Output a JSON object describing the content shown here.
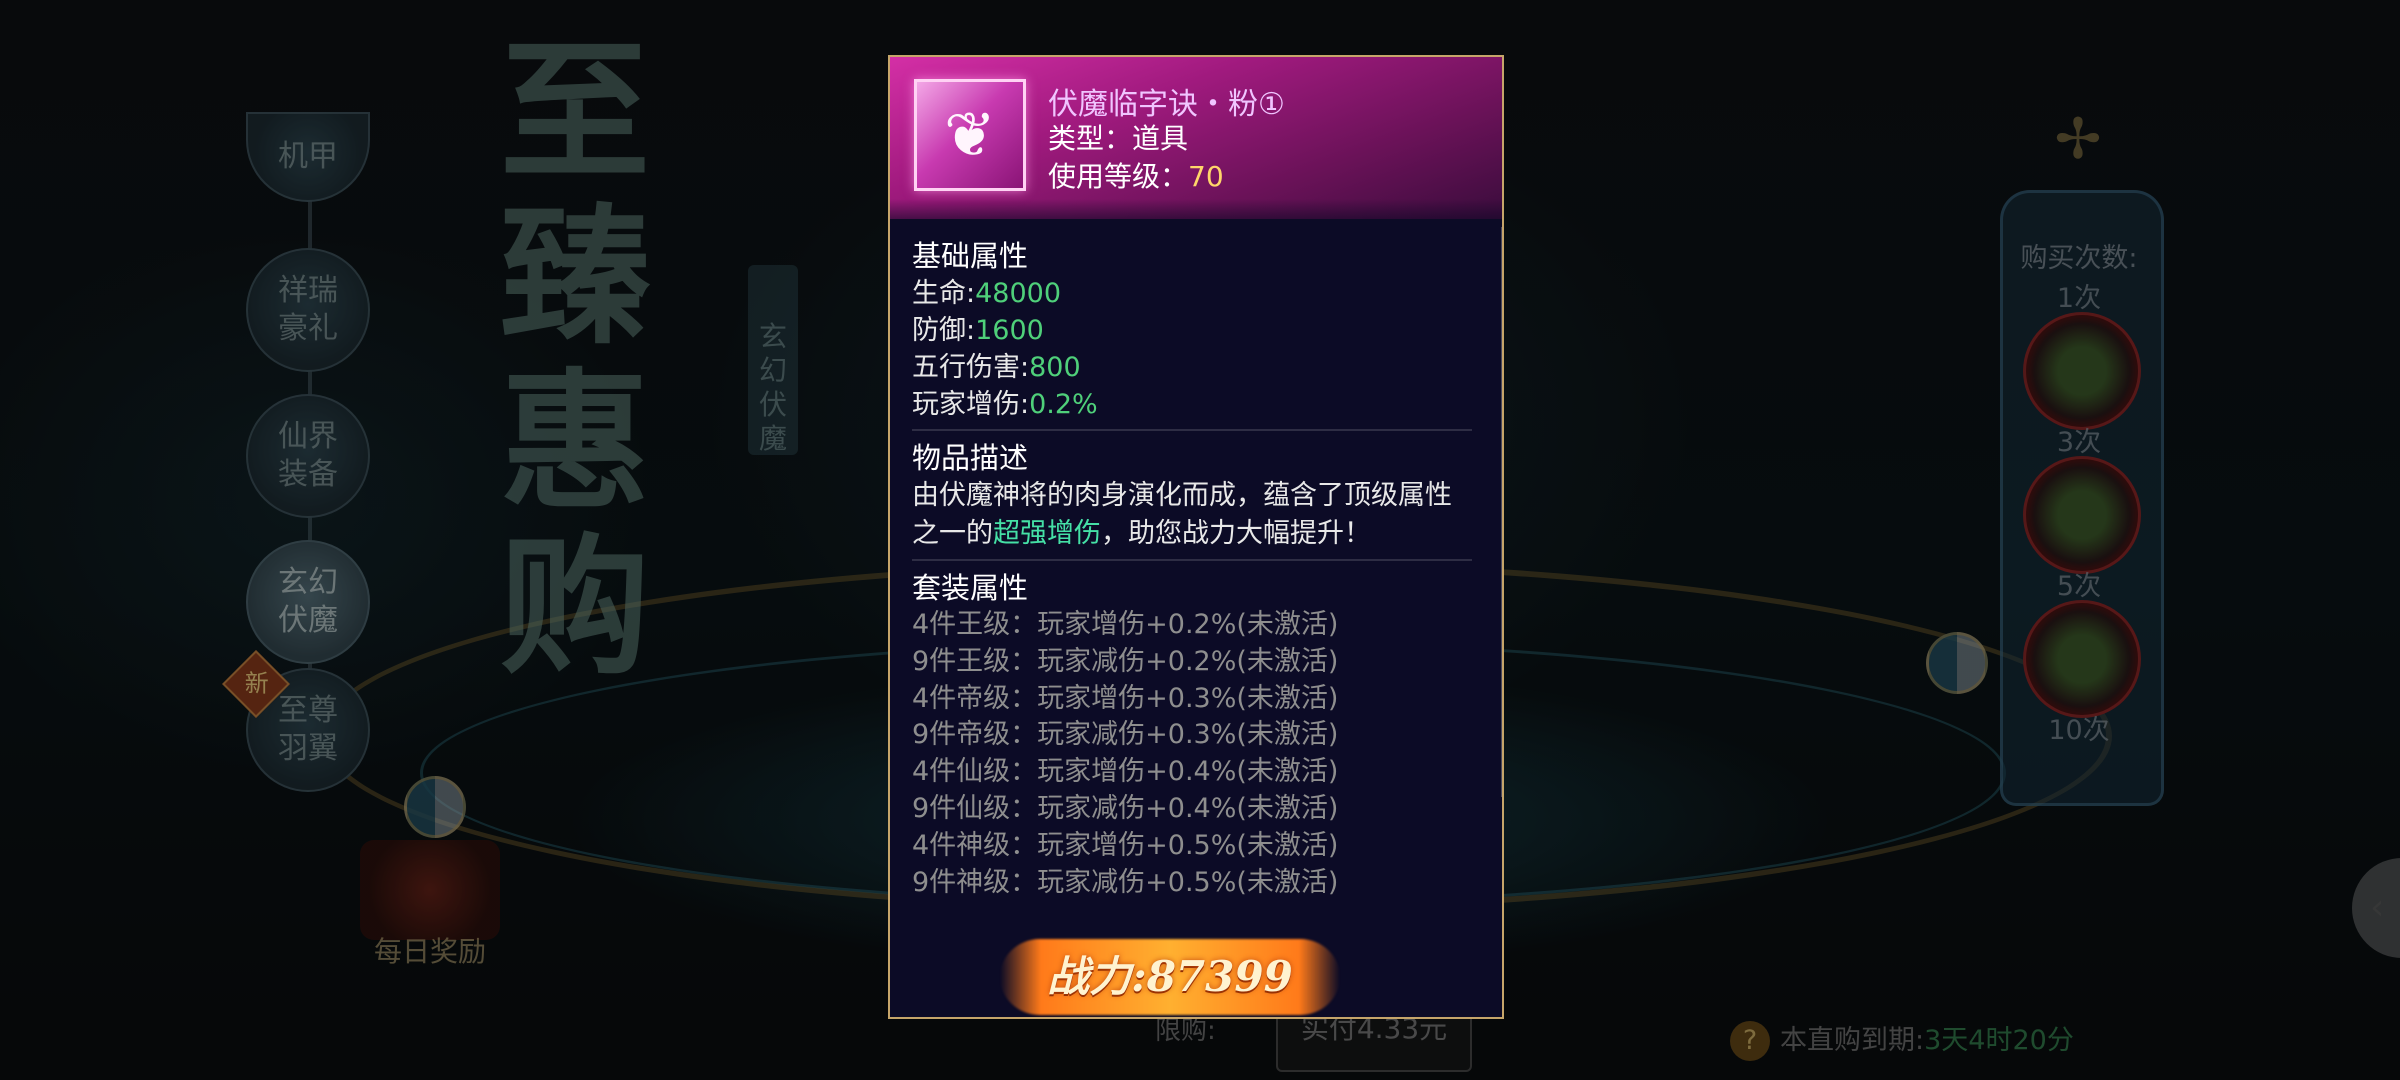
{
  "background": {
    "big_title": "至臻惠购",
    "vertical_tab": "玄幻伏魔",
    "nav": [
      {
        "label": "机甲"
      },
      {
        "label": "祥瑞豪礼"
      },
      {
        "label": "仙界装备"
      },
      {
        "label": "玄幻伏魔",
        "active": true
      },
      {
        "label": "至尊羽翼"
      }
    ],
    "new_badge": "新",
    "daily_reward": "每日奖励",
    "purchase_panel": {
      "title": "购买次数:",
      "counts": [
        "1次",
        "3次",
        "5次",
        "10次"
      ]
    },
    "limit_label": "限购:",
    "price_button": "实付4.33元",
    "expire_label": "本直购到期:",
    "expire_value": "3天4时20分",
    "expire_icon": "?"
  },
  "tooltip": {
    "item_name": "伏魔临字诀・粉①",
    "item_type": "类型：道具",
    "level_label": "使用等级：",
    "level_value": "70",
    "rarity_color": "#c83ab0",
    "base_title": "基础属性",
    "base_stats": [
      {
        "label": "生命:",
        "value": "48000"
      },
      {
        "label": "防御:",
        "value": "1600"
      },
      {
        "label": "五行伤害:",
        "value": "800"
      },
      {
        "label": "玩家增伤:",
        "value": "0.2%"
      }
    ],
    "desc_title": "物品描述",
    "desc_part1": "由伏魔神将的肉身演化而成，蕴含了顶级属性之一的",
    "desc_highlight": "超强增伤",
    "desc_part2": "，助您战力大幅提升！",
    "set_title": "套装属性",
    "set_stats": [
      "4件王级：玩家增伤+0.2%(未激活)",
      "9件王级：玩家减伤+0.2%(未激活)",
      "4件帝级：玩家增伤+0.3%(未激活)",
      "9件帝级：玩家减伤+0.3%(未激活)",
      "4件仙级：玩家增伤+0.4%(未激活)",
      "9件仙级：玩家减伤+0.4%(未激活)",
      "4件神级：玩家增伤+0.5%(未激活)",
      "9件神级：玩家减伤+0.5%(未激活)"
    ],
    "power_label": "战力:87399"
  }
}
